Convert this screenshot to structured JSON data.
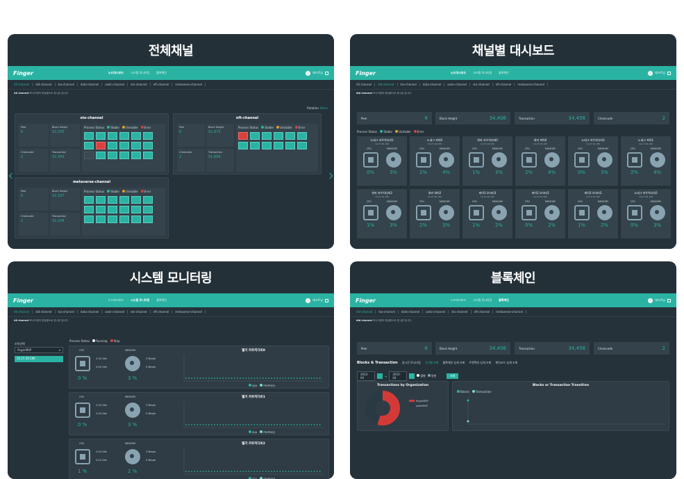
{
  "cards": {
    "all_channels": "전체채널",
    "channel_dashboard": "채널별 대시보드",
    "system_monitoring": "시스템 모니터링",
    "blockchain": "블록체인"
  },
  "app": {
    "logo": "Finger",
    "nav": [
      "노드대시보드",
      "시스템 모니터링",
      "블록체인"
    ],
    "user": "테스트님"
  },
  "channel_tabs": [
    "All channel",
    "did-channel",
    "tsa-channel",
    "data-channel",
    "ozein-channel",
    "sto-channel",
    "nft-channel",
    "metaverse-channel"
  ],
  "subtitle": {
    "bold": "All channel",
    "rest": " 모니터링의 현상황으로 표시된 입니다."
  },
  "subtitle_alt": {
    "bold": "did channel",
    "rest": " 모니터링의 현상황으로 표시된 입니다."
  },
  "overview": {
    "rotation_label": "Rotation",
    "rotation_value": "10sec",
    "process_status": "Process Status",
    "stable": "Stable",
    "unstable": "Unstable",
    "error": "Error",
    "channels": [
      {
        "name": "sto-channel",
        "peer": "6",
        "block_height": "52,335",
        "chaincode": "2",
        "transaction": "52,393"
      },
      {
        "name": "nft-channel",
        "peer": "6",
        "block_height": "51,675",
        "chaincode": "2",
        "transaction": "51,699"
      },
      {
        "name": "metaverse-channel",
        "peer": "6",
        "block_height": "52,167",
        "chaincode": "2",
        "transaction": "52,208"
      }
    ],
    "labels": {
      "peer": "Peer",
      "block_height": "Block Height",
      "chaincode": "Chaincode",
      "transaction": "Transaction"
    }
  },
  "dashboard": {
    "stats": [
      {
        "label": "Peer",
        "value": "6"
      },
      {
        "label": "Block Height",
        "value": "34,406"
      },
      {
        "label": "Transaction",
        "value": "34,458"
      },
      {
        "label": "Chaincode",
        "value": "2"
      }
    ],
    "process_status": "Process Status",
    "nodes": [
      {
        "name": "노네그 카우치디비1",
        "ip": "10.27.26.186",
        "cpu": "0%",
        "mem": "3%"
      },
      {
        "name": "노네그 피어0",
        "ip": "10.27.26.185",
        "cpu": "2%",
        "mem": "4%"
      },
      {
        "name": "워커 카우치디비0",
        "ip": "10.27.26.185",
        "cpu": "1%",
        "mem": "3%"
      },
      {
        "name": "워커 피어0",
        "ip": "10.27.26.185",
        "cpu": "2%",
        "mem": "4%"
      },
      {
        "name": "노네그 카우치디비3",
        "ip": "10.27.26.186",
        "cpu": "0%",
        "mem": "3%"
      },
      {
        "name": "노네그 피어1",
        "ip": "10.27.26.186",
        "cpu": "2%",
        "mem": "4%"
      },
      {
        "name": "워커 카우치디비3",
        "ip": "10.27.26.185",
        "cpu": "1%",
        "mem": "3%"
      },
      {
        "name": "워커 피어2",
        "ip": "10.27.26.185",
        "cpu": "2%",
        "mem": "3%"
      },
      {
        "name": "피어3 오더러3",
        "ip": "10.27.26.185",
        "cpu": "1%",
        "mem": "2%"
      },
      {
        "name": "피어3 오더러3",
        "ip": "10.27.26.185",
        "cpu": "0%",
        "mem": "2%"
      },
      {
        "name": "피어3 오더러3",
        "ip": "10.27.26.185",
        "cpu": "1%",
        "mem": "2%"
      },
      {
        "name": "노네그 카우치디비2",
        "ip": "10.27.26.186",
        "cpu": "0%",
        "mem": "3%"
      }
    ],
    "cpu_label": "CPU",
    "mem_label": "MEMORY"
  },
  "monitoring": {
    "org_label": "조직선택",
    "org_value": "fingerMSP",
    "node_ip": "10.27.26.186",
    "process_status": "Process Status",
    "running": "Running",
    "stop": "Stop",
    "nodes": [
      {
        "title": "웹거 카우치디비0",
        "cpu": "0 %",
        "mem": "3 %",
        "ghz": "4.30 GHz",
        "cpu2": "0.00 GHz",
        "mb1": "3 Mbyte",
        "mb2": "0 Mbyte"
      },
      {
        "title": "웹거 카우치디비1",
        "cpu": "0 %",
        "mem": "3 %",
        "ghz": "4.30 GHz",
        "cpu2": "0.00 GHz",
        "mb1": "3 Mbyte",
        "mb2": "0 Mbyte"
      },
      {
        "title": "웹거 카우치디비2",
        "cpu": "1 %",
        "mem": "2 %",
        "ghz": "4.30 GHz",
        "cpu2": "0.04 GHz",
        "mb1": "3 Mbyte",
        "mb2": "0 Mbyte"
      }
    ],
    "cpu_label": "CPU",
    "mem_label": "MEMORY",
    "legend_cpu": "cpu",
    "legend_memory": "memory"
  },
  "blockchain": {
    "stats": [
      {
        "label": "Peer",
        "value": "6"
      },
      {
        "label": "Block Height",
        "value": "34,406"
      },
      {
        "label": "Transaction",
        "value": "34,458"
      },
      {
        "label": "Chaincode",
        "value": "2"
      }
    ],
    "section_title": "Blocks & Transaction",
    "subtabs": [
      "실시간 모니터링",
      "기간별 조회",
      "블록체인 상세 조회",
      "트랜잭션 상세 조회",
      "체인코드 상세 조회"
    ],
    "date_from": "2023-04",
    "date_to": "2023-04",
    "radio_month": "월별",
    "radio_day": "일별",
    "search": "조회",
    "pie_title": "Transactions by Organization",
    "pie_legend": [
      "fingerMSP",
      "ozeinMSP"
    ],
    "line_title": "Blocks or Transaction Transition",
    "line_legend": [
      "Blocks",
      "Transaction"
    ]
  }
}
